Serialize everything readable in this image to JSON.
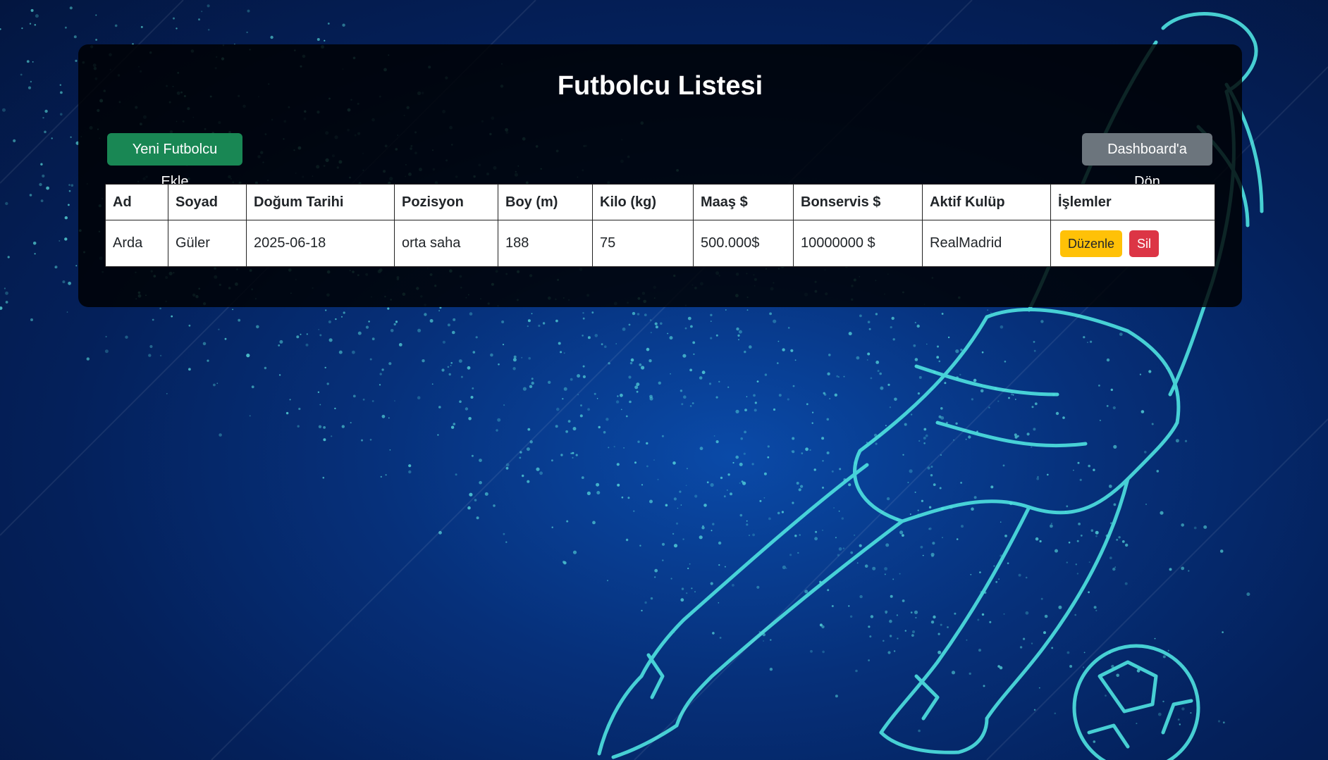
{
  "page": {
    "title": "Futbolcu Listesi"
  },
  "toolbar": {
    "add_label": "Yeni Futbolcu Ekle",
    "back_label": "Dashboard'a Dön"
  },
  "table": {
    "headers": [
      "Ad",
      "Soyad",
      "Doğum Tarihi",
      "Pozisyon",
      "Boy (m)",
      "Kilo (kg)",
      "Maaş $",
      "Bonservis $",
      "Aktif Kulüp",
      "İşlemler"
    ],
    "rows": [
      {
        "ad": "Arda",
        "soyad": "Güler",
        "dogum_tarihi": "2025-06-18",
        "pozisyon": "orta saha",
        "boy": "188",
        "kilo": "75",
        "maas": "500.000$",
        "bonservis": "10000000 $",
        "kulup": "RealMadrid",
        "edit_label": "Düzenle",
        "delete_label": "Sil"
      }
    ]
  },
  "colors": {
    "add_button": "#198754",
    "back_button": "#6c757d",
    "edit_button": "#ffc107",
    "delete_button": "#dc3545",
    "background": "#06307a",
    "illustration": "#4fe3e0"
  }
}
